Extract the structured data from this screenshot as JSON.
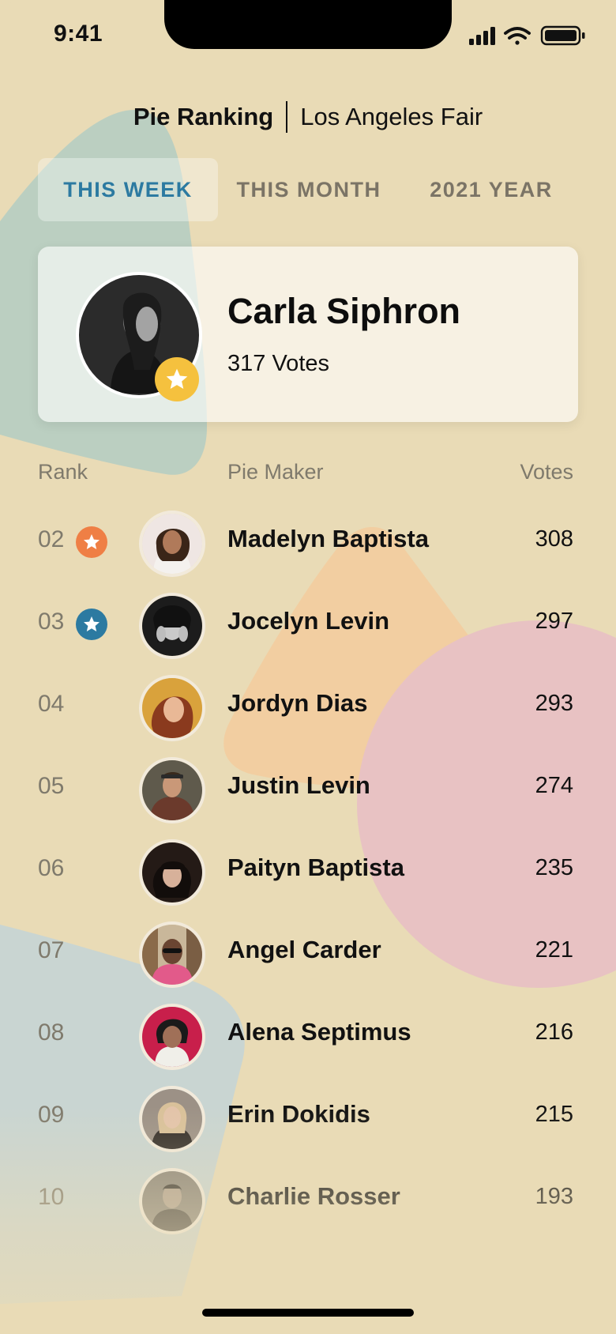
{
  "status_bar": {
    "time": "9:41"
  },
  "header": {
    "app_title": "Pie Ranking",
    "location": "Los Angeles Fair"
  },
  "tabs": [
    {
      "label": "THIS WEEK",
      "active": true
    },
    {
      "label": "THIS MONTH",
      "active": false
    },
    {
      "label": "2021 YEAR",
      "active": false
    }
  ],
  "winner": {
    "name": "Carla Siphron",
    "votes": "317 Votes",
    "badge_icon": "star-icon",
    "badge_color": "#f5c13e"
  },
  "columns": {
    "rank": "Rank",
    "maker": "Pie Maker",
    "votes": "Votes"
  },
  "rows": [
    {
      "rank": "02",
      "name": "Madelyn Baptista",
      "votes": "308",
      "badge": "star-icon",
      "badge_color": "#ef7f45"
    },
    {
      "rank": "03",
      "name": "Jocelyn Levin",
      "votes": "297",
      "badge": "star-icon",
      "badge_color": "#2c7aa1"
    },
    {
      "rank": "04",
      "name": "Jordyn Dias",
      "votes": "293"
    },
    {
      "rank": "05",
      "name": "Justin Levin",
      "votes": "274"
    },
    {
      "rank": "06",
      "name": "Paityn Baptista",
      "votes": "235"
    },
    {
      "rank": "07",
      "name": "Angel Carder",
      "votes": "221"
    },
    {
      "rank": "08",
      "name": "Alena Septimus",
      "votes": "216"
    },
    {
      "rank": "09",
      "name": "Erin Dokidis",
      "votes": "215"
    },
    {
      "rank": "10",
      "name": "Charlie Rosser",
      "votes": "193"
    }
  ],
  "colors": {
    "background": "#e9dbb6",
    "accent_blue": "#2c7aa1",
    "accent_orange": "#ef7f45",
    "gold": "#f5c13e"
  }
}
